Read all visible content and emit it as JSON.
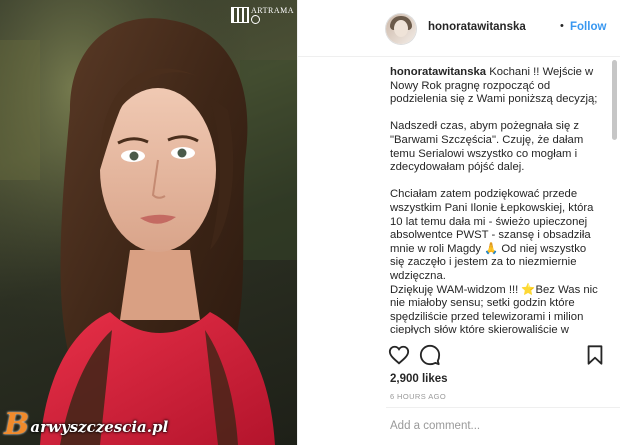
{
  "photo": {
    "watermark_top": "ARTRAMA",
    "watermark_bottom_initial": "B",
    "watermark_bottom_text": "arwyszczescia.pl"
  },
  "header": {
    "username": "honoratawitanska",
    "separator": "•",
    "follow_label": "Follow"
  },
  "caption": {
    "username": "honoratawitanska",
    "paragraphs": [
      "Kochani !! Wejście w Nowy Rok pragnę rozpocząć od podzielenia się z Wami poniższą decyzją;",
      "Nadszedł czas, abym pożegnała się z \"Barwami Szczęścia\". Czuję, że dałam temu Serialowi wszystko co mogłam i zdecydowałam pójść dalej.",
      "Chciałam zatem podziękować przede wszystkim Pani Ilonie Łepkowskiej, która 10 lat temu dała mi - świeżo upieczonej absolwentce PWST - szansę i obsadziła mnie w roli Magdy 🙏 Od niej wszystko się zaczęło i jestem za to niezmiernie wdzięczna.\nDziękuję WAM-widzom !!! ⭐Bez Was nic nie miałoby sensu; setki godzin które spędziliście przed telewizorami i milion ciepłych słów które skierowaliście w"
    ]
  },
  "actions": {
    "like_icon": "heart-icon",
    "comment_icon": "comment-icon",
    "save_icon": "bookmark-icon"
  },
  "likes": "2,900 likes",
  "time": "6 HOURS AGO",
  "comment_placeholder": "Add a comment...",
  "colors": {
    "follow": "#3897f0",
    "text": "#262626",
    "muted": "#999999",
    "dress": "#d8203a",
    "watermark_orange": "#f08a2b"
  }
}
